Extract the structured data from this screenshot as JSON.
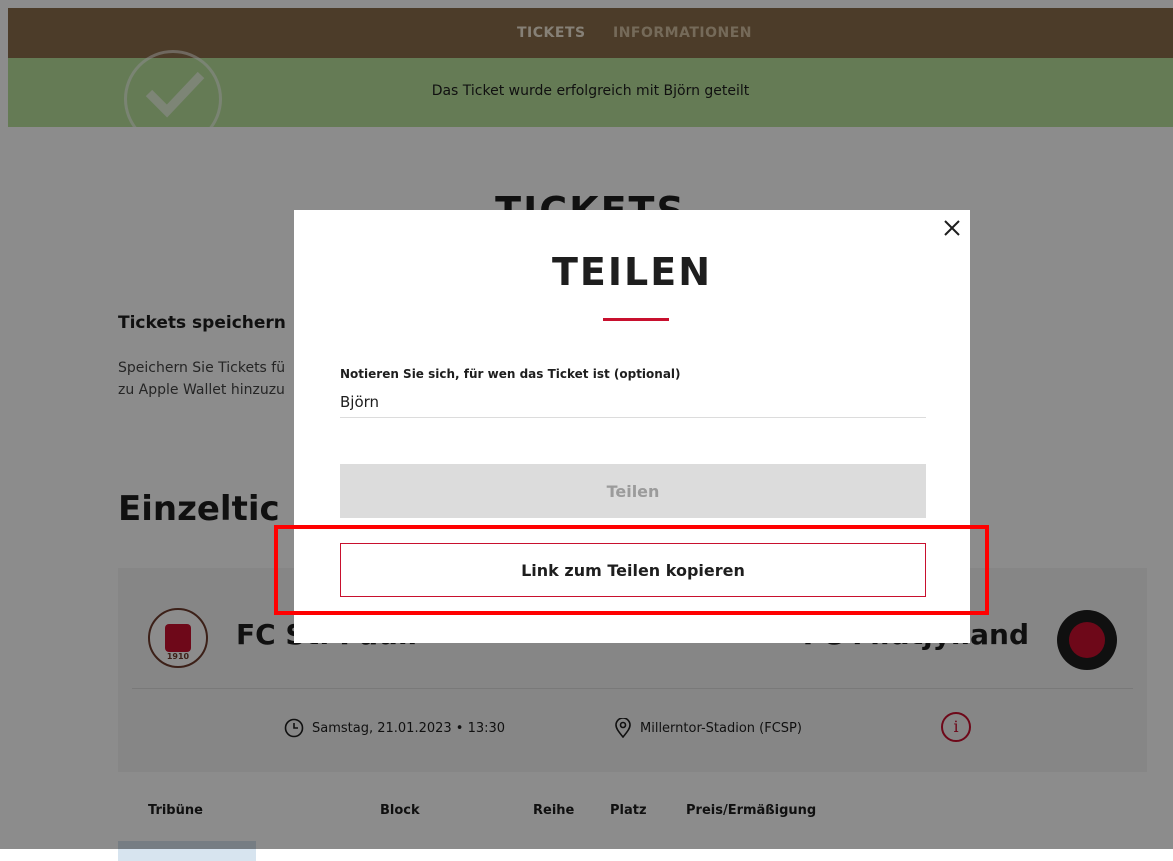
{
  "nav": {
    "tabs": [
      {
        "label": "TICKETS"
      },
      {
        "label": "INFORMATIONEN"
      }
    ]
  },
  "banner": {
    "message": "Das Ticket wurde erfolgreich mit Björn geteilt"
  },
  "page": {
    "heading": "TICKETS",
    "save_title": "Tickets speichern",
    "save_text": "Speichern Sie Tickets fü zu Apple Wallet hinzuzu",
    "section_title": "Einzeltic"
  },
  "match": {
    "home_team": "FC St. Pauli",
    "away_team": "FC Midtjylland",
    "home_logo_year": "1910",
    "date": "Samstag, 21.01.2023 • 13:30",
    "venue": "Millerntor-Stadion (FCSP)",
    "info_icon": "i"
  },
  "table": {
    "headers": [
      "Tribüne",
      "Block",
      "Reihe",
      "Platz",
      "Preis/Ermäßigung"
    ]
  },
  "modal": {
    "title": "TEILEN",
    "field_label": "Notieren Sie sich, für wen das Ticket ist (optional)",
    "field_value": "Björn",
    "share_label": "Teilen",
    "copy_link_label": "Link zum Teilen kopieren"
  },
  "colors": {
    "nav_bg": "#8a6e4b",
    "banner_bg": "#b9e09c",
    "accent_red": "#c8102e",
    "highlight": "#ff0000"
  }
}
